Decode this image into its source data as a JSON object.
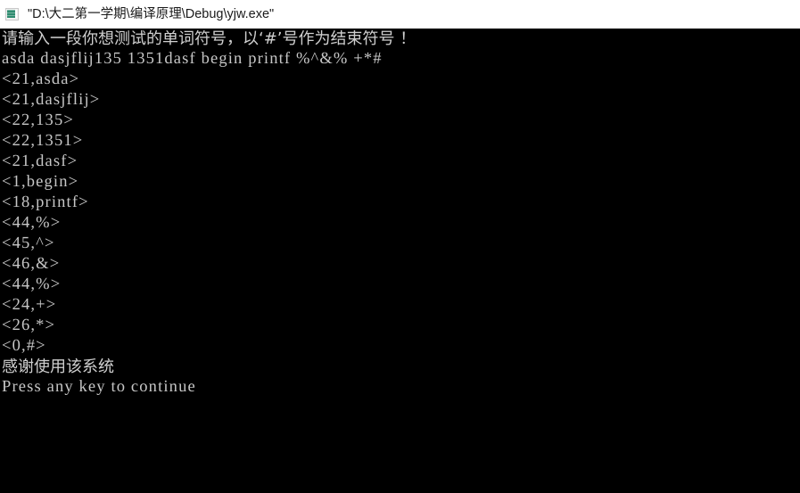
{
  "window": {
    "title": "\"D:\\大二第一学期\\编译原理\\Debug\\yjw.exe\"",
    "icon": "console-app-icon",
    "background_color": "#000000",
    "titlebar_color": "#ffffff",
    "text_color": "#c6c6c6"
  },
  "console": {
    "prompt_line": "请输入一段你想测试的单词符号，以‘#’号作为结束符号 ！",
    "input_line": "asda dasjflij135 1351dasf begin printf %^&% +*#",
    "tokens": [
      "<21,asda>",
      "<21,dasjflij>",
      "<22,135>",
      "<22,1351>",
      "<21,dasf>",
      "<1,begin>",
      "<18,printf>",
      "<44,%>",
      "<45,^>",
      "<46,&>",
      "<44,%>",
      "<24,+>",
      "<26,*>",
      "<0,#>"
    ],
    "thanks_line": "感谢使用该系统",
    "press_any_key": "Press any key to continue"
  }
}
